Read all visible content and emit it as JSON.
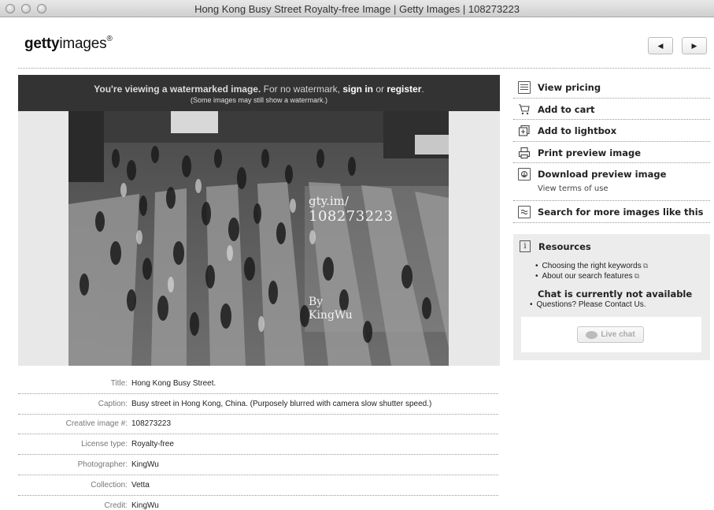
{
  "window": {
    "title": "Hong Kong Busy Street Royalty-free Image | Getty Images | 108273223"
  },
  "header": {
    "logo_bold": "getty",
    "logo_light": "images",
    "logo_mark": "®",
    "prev_icon": "◀",
    "next_icon": "▶"
  },
  "watermark_notice": {
    "part1": "You're viewing a watermarked image.",
    "part2": " For no watermark, ",
    "sign_in": "sign in",
    "or": " or ",
    "register": "register",
    "end": ".",
    "note": "(Some images may still show a watermark.)"
  },
  "image_watermark": {
    "line1": "gty.im/",
    "line2": "108273223",
    "by": "By",
    "author": "KingWu"
  },
  "details": [
    {
      "key": "Title:",
      "value": "Hong Kong Busy Street."
    },
    {
      "key": "Caption:",
      "value": "Busy street in Hong Kong, China. (Purposely blurred with camera slow shutter speed.)"
    },
    {
      "key": "Creative image #:",
      "value": "108273223"
    },
    {
      "key": "License type:",
      "value": "Royalty-free"
    },
    {
      "key": "Photographer:",
      "value": "KingWu"
    },
    {
      "key": "Collection:",
      "value": "Vetta"
    },
    {
      "key": "Credit:",
      "value": "KingWu"
    }
  ],
  "actions": {
    "view_pricing": "View pricing",
    "add_to_cart": "Add to cart",
    "add_to_lightbox": "Add to lightbox",
    "print_preview": "Print preview image",
    "download_preview": "Download preview image",
    "terms": "View terms of use",
    "search_more": "Search for more images like this"
  },
  "resources": {
    "title": "Resources",
    "links": [
      "Choosing the right keywords",
      "About our search features"
    ],
    "chat_status": "Chat is currently not available",
    "questions": "Questions? Please Contact Us.",
    "live_chat": "Live chat"
  },
  "icons": {
    "pricing": "calculator-icon",
    "cart": "cart-icon",
    "lightbox": "lightbox-icon",
    "print": "printer-icon",
    "download": "download-icon",
    "search_similar": "similar-search-icon",
    "info": "info-icon"
  }
}
